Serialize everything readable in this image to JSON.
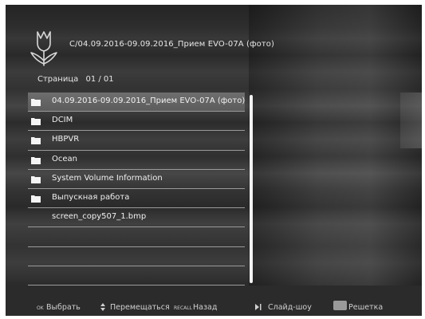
{
  "header": {
    "path": "C/04.09.2016-09.09.2016_Прием EVO-07A (фото)"
  },
  "pager": {
    "label": "Страница",
    "value": "01 / 01"
  },
  "file_list": {
    "items": [
      {
        "name": "04.09.2016-09.09.2016_Прием EVO-07A (фото)",
        "type": "folder",
        "selected": true
      },
      {
        "name": "DCIM",
        "type": "folder"
      },
      {
        "name": "HBPVR",
        "type": "folder"
      },
      {
        "name": "Ocean",
        "type": "folder"
      },
      {
        "name": "System Volume Information",
        "type": "folder"
      },
      {
        "name": "Выпускная работа",
        "type": "folder"
      },
      {
        "name": "screen_copy507_1.bmp",
        "type": "file"
      },
      {
        "name": "",
        "type": "empty"
      },
      {
        "name": "",
        "type": "empty"
      },
      {
        "name": "",
        "type": "empty"
      }
    ]
  },
  "footer": {
    "ok_key": "OK",
    "select": "Выбрать",
    "move": "Перемещаться",
    "recall_key": "RECALL",
    "back": "Назад",
    "slideshow": "Слайд-шоу",
    "grid": "Решетка"
  },
  "colors": {
    "text": "#f0f0f0",
    "selected_row": "#6e6e6e",
    "divider": "#9a9a9a",
    "scrollbar": "#f2f2f2"
  }
}
